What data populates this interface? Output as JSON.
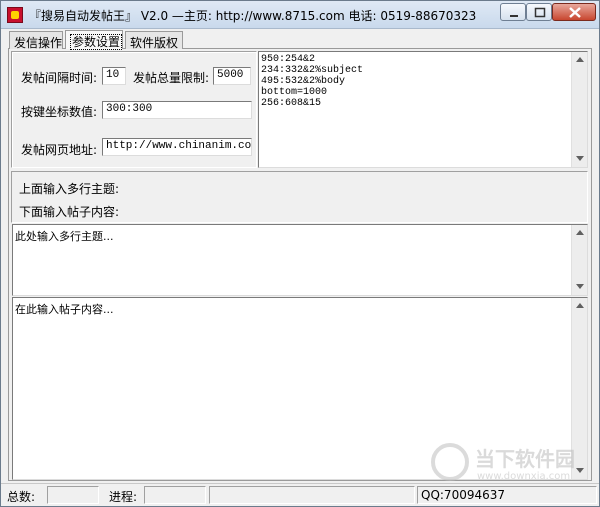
{
  "window": {
    "title": "『搜易自动发帖王』 V2.0  —主页: http://www.8715.com 电话: 0519-88670323"
  },
  "tabs": [
    {
      "label": "发信操作"
    },
    {
      "label": "参数设置"
    },
    {
      "label": "软件版权"
    }
  ],
  "settings": {
    "interval_label": "发帖间隔时间:",
    "interval_value": "10",
    "total_label": "发帖总量限制:",
    "total_value": "5000",
    "coord_label": "按键坐标数值:",
    "coord_value": "300:300",
    "url_label": "发帖网页地址:",
    "url_value": "http://www.chinanim.com/bb"
  },
  "coords_list": [
    "950:254&2",
    "234:332&2%subject",
    "495:532&2%body",
    "bottom=1000",
    "256:608&15"
  ],
  "info": {
    "line1": "上面输入多行主题:",
    "line2": "下面输入帖子内容:"
  },
  "subject_area": {
    "placeholder": "此处输入多行主题..."
  },
  "content_area": {
    "placeholder": "在此输入帖子内容..."
  },
  "statusbar": {
    "total_label": "总数:",
    "total_value": "",
    "progress_label": "进程:",
    "progress_value": "",
    "qq": "QQ:70094637"
  },
  "watermark": {
    "brand": "当下软件园",
    "url": "www.downxia.com"
  },
  "icons": {
    "app": "app-logo-icon",
    "minimize": "minimize-icon",
    "maximize": "maximize-icon",
    "close": "close-icon",
    "scroll_up": "chevron-up-icon",
    "scroll_down": "chevron-down-icon"
  }
}
